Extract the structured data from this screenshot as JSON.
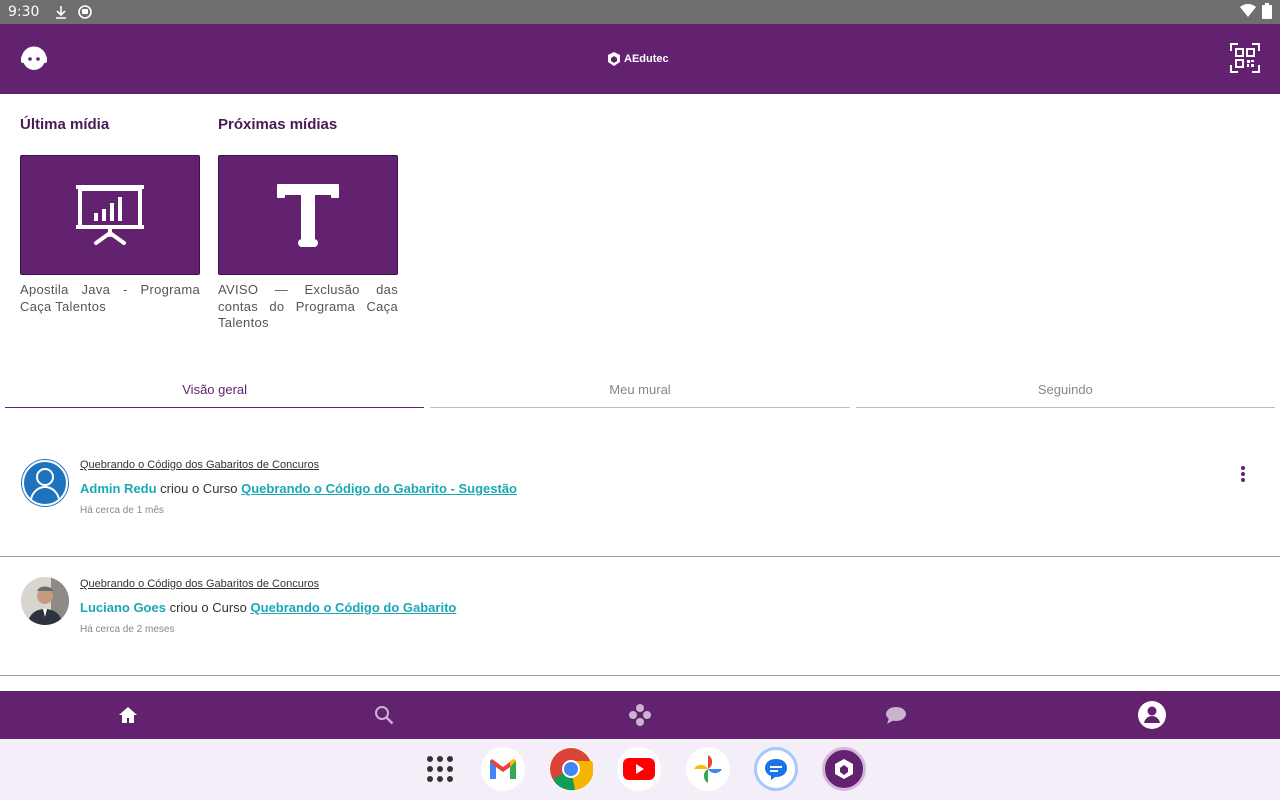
{
  "status_bar": {
    "time": "9:30",
    "icons": [
      "download-icon",
      "app-status-icon"
    ],
    "right_icons": [
      "wifi-icon",
      "battery-icon"
    ]
  },
  "app_bar": {
    "left_icon": "support-agent-icon",
    "logo_text": "AEdutec",
    "right_icon": "qr-code-icon"
  },
  "media": {
    "last": {
      "title": "Última mídia",
      "icon": "presentation-chart-icon",
      "caption": "Apostila Java - Programa Caça Talentos"
    },
    "next": {
      "title": "Próximas mídias",
      "icon": "text-t-icon",
      "caption": "AVISO — Exclusão das contas do Programa Caça Talentos"
    }
  },
  "tabs": [
    {
      "label": "Visão geral",
      "active": true
    },
    {
      "label": "Meu mural",
      "active": false
    },
    {
      "label": "Seguindo",
      "active": false
    }
  ],
  "feed": [
    {
      "group": "Quebrando o Código dos Gabaritos de Concuros",
      "user": "Admin Redu",
      "action": " criou o Curso ",
      "course": "Quebrando o Código do Gabarito - Sugestão",
      "time": "Há cerca de 1 mês",
      "avatar": "default-user-avatar"
    },
    {
      "group": "Quebrando o Código dos Gabaritos de Concuros",
      "user": "Luciano Goes",
      "action": " criou o Curso ",
      "course": "Quebrando o Código do Gabarito",
      "time": "Há cerca de 2 meses",
      "avatar": "photo-avatar"
    }
  ],
  "bottom_nav": [
    "home-icon",
    "search-icon",
    "games-icon",
    "chat-icon",
    "profile-icon"
  ],
  "dock": [
    "apps-grid-icon",
    "gmail-icon",
    "chrome-icon",
    "youtube-icon",
    "photos-icon",
    "messages-icon",
    "aedutec-icon"
  ],
  "colors": {
    "primary": "#632270",
    "accent": "#1aa9b4",
    "statusbar": "#6f6f6f"
  }
}
